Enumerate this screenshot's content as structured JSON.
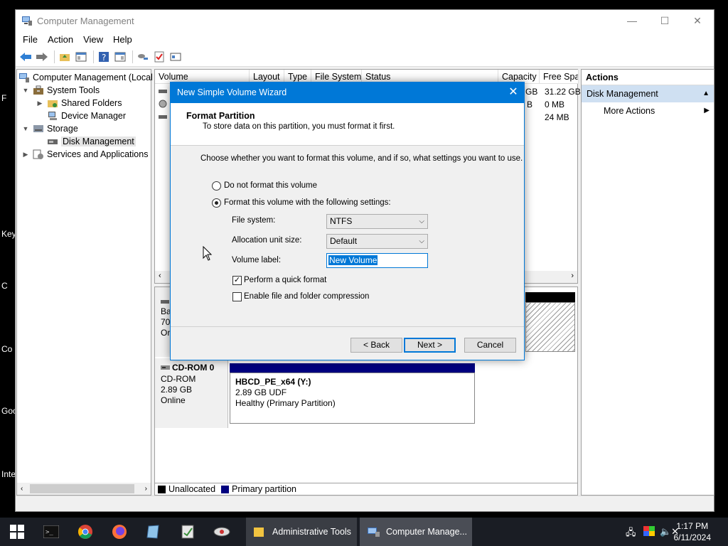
{
  "desktop": {
    "side_labels": [
      "F",
      "Key",
      "C",
      "Co",
      "Goo",
      "Inte"
    ]
  },
  "window": {
    "title": "Computer Management",
    "controls": {
      "minimize": "—",
      "maximize": "☐",
      "close": "✕"
    }
  },
  "menu": [
    "File",
    "Action",
    "View",
    "Help"
  ],
  "tree": {
    "root": "Computer Management (Local",
    "system_tools": "System Tools",
    "shared_folders": "Shared Folders",
    "device_manager": "Device Manager",
    "storage": "Storage",
    "disk_management": "Disk Management",
    "services": "Services and Applications"
  },
  "volume_list": {
    "columns": [
      "Volume",
      "Layout",
      "Type",
      "File System",
      "Status",
      "Capacity",
      "Free Spa"
    ],
    "capacity_col": [
      "GB",
      "B",
      ""
    ],
    "free_col": [
      "31.22 GB",
      "0 MB",
      "24 MB"
    ]
  },
  "disk_area": {
    "disk0_partial": [
      "Ba",
      "70.",
      "Or"
    ],
    "cdrom": {
      "name": "CD-ROM 0",
      "type": "CD-ROM",
      "size": "2.89 GB",
      "status": "Online",
      "partition_title": "HBCD_PE_x64  (Y:)",
      "partition_size": "2.89 GB UDF",
      "partition_status": "Healthy (Primary Partition)"
    },
    "legend": {
      "unallocated": "Unallocated",
      "primary": "Primary partition"
    }
  },
  "actions": {
    "heading": "Actions",
    "section": "Disk Management",
    "more": "More Actions"
  },
  "dialog": {
    "title": "New Simple Volume Wizard",
    "header_title": "Format Partition",
    "header_sub": "To store data on this partition, you must format it first.",
    "instruction": "Choose whether you want to format this volume, and if so, what settings you want to use.",
    "opt_no_format": "Do not format this volume",
    "opt_format": "Format this volume with the following settings:",
    "file_system_label": "File system:",
    "file_system_value": "NTFS",
    "alloc_label": "Allocation unit size:",
    "alloc_value": "Default",
    "volume_label_label": "Volume label:",
    "volume_label_value": "New Volume",
    "quick_format": "Perform a quick format",
    "compression": "Enable file and folder compression",
    "back": "< Back",
    "next": "Next >",
    "cancel": "Cancel"
  },
  "taskbar": {
    "apps": [
      "Administrative Tools",
      "Computer Manage..."
    ],
    "time": "1:17 PM",
    "date": "6/11/2024"
  },
  "colors": {
    "accent": "#0078d7",
    "primary_partition": "#00007f",
    "taskbar": "#1a1d24"
  }
}
